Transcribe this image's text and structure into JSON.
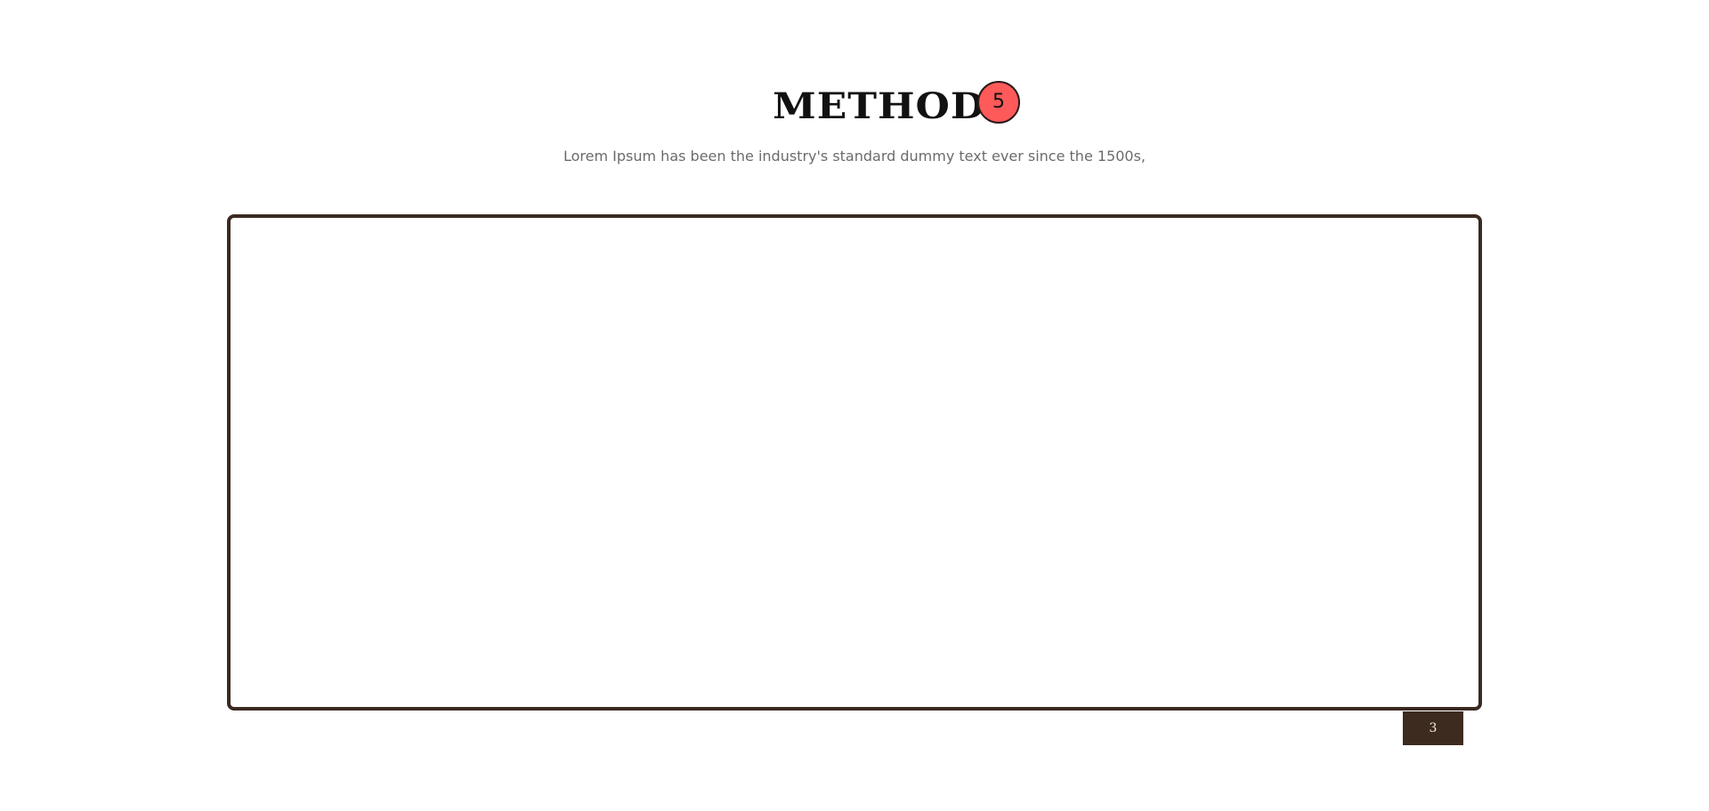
{
  "header": {
    "title": "METHOD",
    "badge": "5",
    "subtitle": "Lorem Ipsum has been the industry's standard dummy text ever since the 1500s,"
  },
  "panel": {
    "page_number": "3"
  },
  "colors": {
    "badge_fill": "#ff5a5a",
    "panel_border": "#3a2a22",
    "page_tag_fill": "#3d2b20",
    "subtitle_text": "#6b6b6b"
  }
}
